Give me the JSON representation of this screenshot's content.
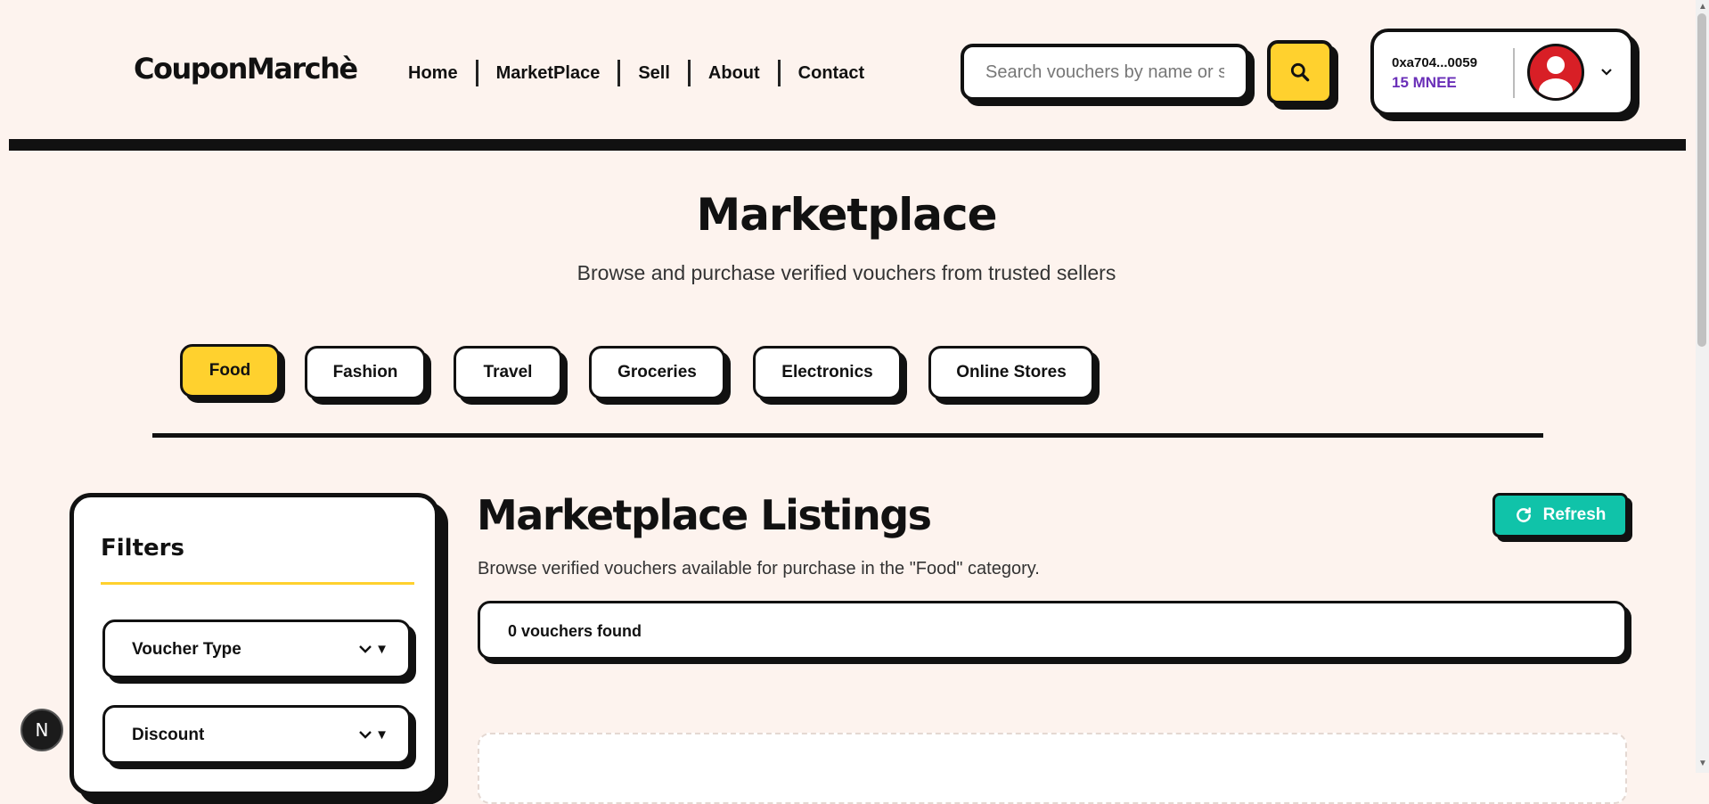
{
  "header": {
    "logo": "CouponMarchè",
    "nav": [
      "Home",
      "MarketPlace",
      "Sell",
      "About",
      "Contact"
    ],
    "search_placeholder": "Search vouchers by name or store",
    "wallet_address": "0xa704...0059",
    "wallet_balance": "15 MNEE"
  },
  "hero": {
    "title": "Marketplace",
    "subtitle": "Browse and purchase verified vouchers from trusted sellers"
  },
  "categories": {
    "items": [
      "Food",
      "Fashion",
      "Travel",
      "Groceries",
      "Electronics",
      "Online Stores"
    ],
    "active": "Food"
  },
  "filters": {
    "title": "Filters",
    "selects": [
      "Voucher Type",
      "Discount"
    ]
  },
  "listings": {
    "title": "Marketplace Listings",
    "subtitle": "Browse verified vouchers available for purchase in the \"Food\" category.",
    "refresh_label": "Refresh",
    "count_text": "0 vouchers found"
  },
  "misc": {
    "dev_badge": "N"
  },
  "colors": {
    "background": "#fdf3ee",
    "accent_yellow": "#ffd12e",
    "refresh_teal": "#10c3a9",
    "balance_purple": "#6a2fb8",
    "avatar_red": "#d81f26"
  }
}
